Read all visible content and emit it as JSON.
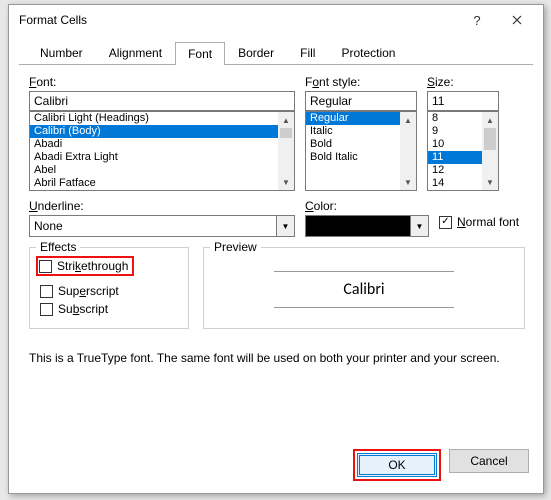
{
  "window": {
    "title": "Format Cells"
  },
  "tabs": [
    "Number",
    "Alignment",
    "Font",
    "Border",
    "Fill",
    "Protection"
  ],
  "active_tab": "Font",
  "font": {
    "label": "Font:",
    "value": "Calibri",
    "items": [
      "Calibri Light (Headings)",
      "Calibri (Body)",
      "Abadi",
      "Abadi Extra Light",
      "Abel",
      "Abril Fatface"
    ],
    "selected": "Calibri (Body)"
  },
  "style": {
    "label": "Font style:",
    "value": "Regular",
    "items": [
      "Regular",
      "Italic",
      "Bold",
      "Bold Italic"
    ],
    "selected": "Regular"
  },
  "size": {
    "label": "Size:",
    "value": "11",
    "items": [
      "8",
      "9",
      "10",
      "11",
      "12",
      "14"
    ],
    "selected": "11"
  },
  "underline": {
    "label": "Underline:",
    "value": "None"
  },
  "color": {
    "label": "Color:",
    "value": "#000000"
  },
  "normal_font": {
    "label": "Normal font",
    "checked": true
  },
  "effects": {
    "legend": "Effects",
    "strike": "Strikethrough",
    "super": "Superscript",
    "sub": "Subscript"
  },
  "preview": {
    "legend": "Preview",
    "sample": "Calibri"
  },
  "hint": "This is a TrueType font.  The same font will be used on both your printer and your screen.",
  "buttons": {
    "ok": "OK",
    "cancel": "Cancel"
  }
}
